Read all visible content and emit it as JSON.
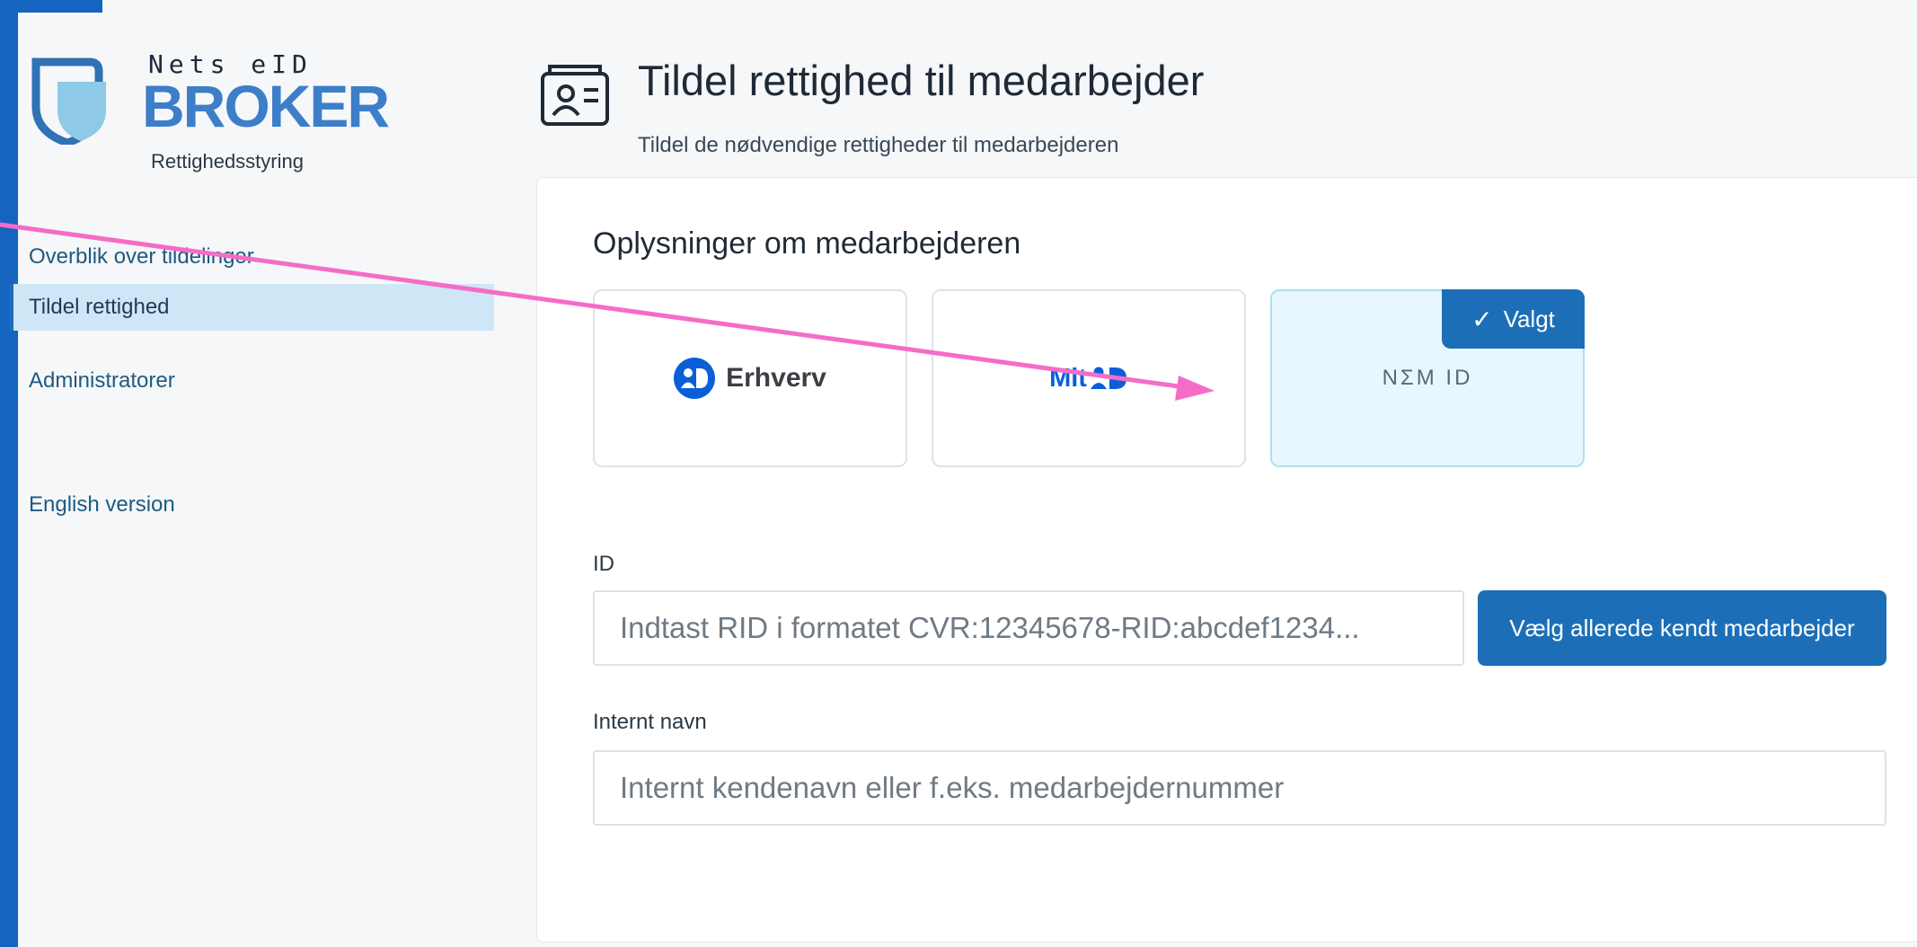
{
  "brand": {
    "line1": "Nets eID",
    "line2": "BROKER",
    "subtitle": "Rettighedsstyring"
  },
  "sidebar": {
    "items": [
      {
        "label": "Overblik over tildelinger"
      },
      {
        "label": "Tildel rettighed"
      },
      {
        "label": "Administratorer"
      },
      {
        "label": "English version"
      }
    ]
  },
  "header": {
    "title": "Tildel rettighed til medarbejder",
    "subtitle": "Tildel de nødvendige rettigheder til medarbejderen"
  },
  "card": {
    "title": "Oplysninger om medarbejderen",
    "id_options": [
      {
        "label": "Erhverv"
      },
      {
        "label": "Mit"
      },
      {
        "label": "NΣM ID"
      }
    ],
    "selected_tag": "Valgt",
    "id_label": "ID",
    "id_placeholder": "Indtast RID i formatet CVR:12345678-RID:abcdef1234...",
    "choose_button": "Vælg allerede kendt medarbejder",
    "name_label": "Internt navn",
    "name_placeholder": "Internt kendenavn eller f.eks. medarbejdernummer"
  },
  "colors": {
    "frame": "#1565c0",
    "accent": "#1c6fb7",
    "annotation_arrow": "#f56cc8",
    "selected_bg": "#e8f7fd"
  }
}
